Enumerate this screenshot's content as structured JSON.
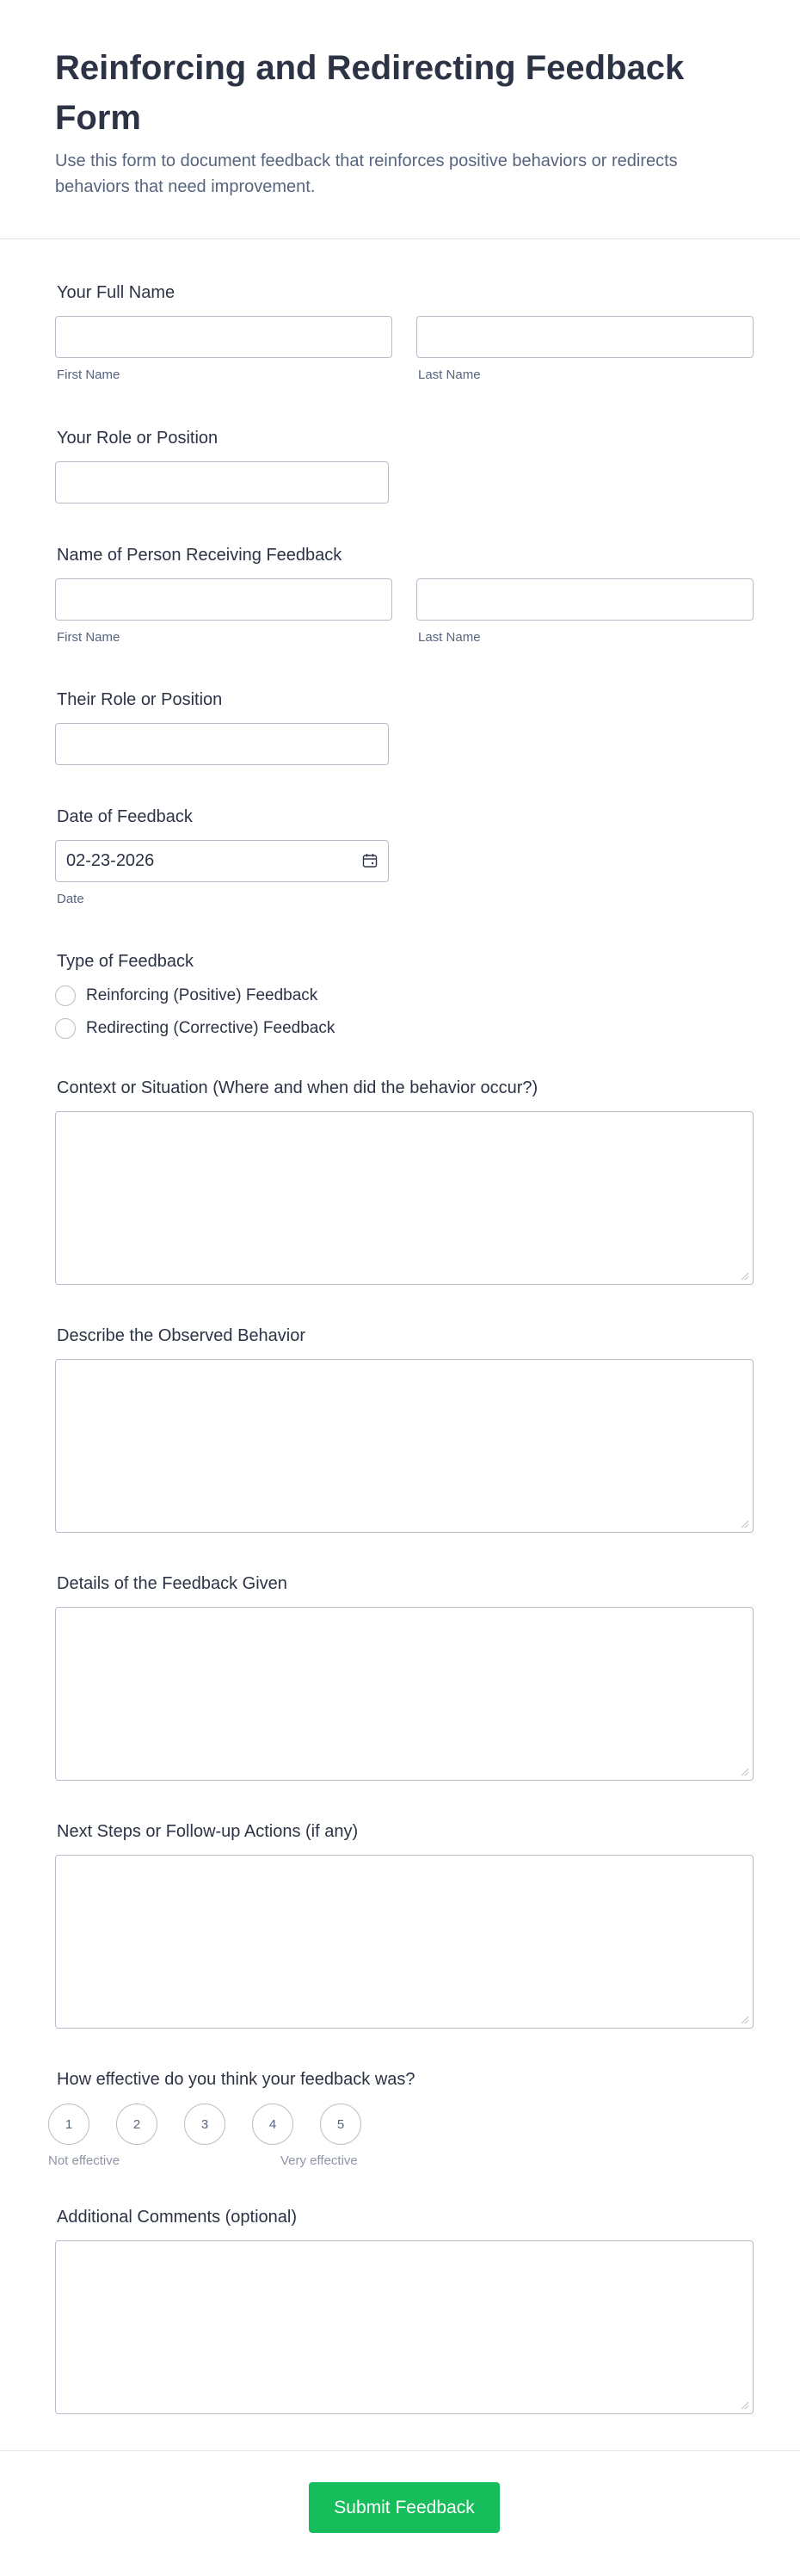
{
  "form": {
    "title": "Reinforcing and Redirecting Feedback Form",
    "subtitle": "Use this form to document feedback that reinforces positive behaviors or redirects behaviors that need improvement."
  },
  "fields": {
    "full_name": {
      "label": "Your Full Name",
      "first_value": "",
      "last_value": "",
      "first_sublabel": "First Name",
      "last_sublabel": "Last Name"
    },
    "role": {
      "label": "Your Role or Position",
      "value": ""
    },
    "receiver_name": {
      "label": "Name of Person Receiving Feedback",
      "first_value": "",
      "last_value": "",
      "first_sublabel": "First Name",
      "last_sublabel": "Last Name"
    },
    "their_role": {
      "label": "Their Role or Position",
      "value": ""
    },
    "date": {
      "label": "Date of Feedback",
      "value": "02-23-2026",
      "sublabel": "Date",
      "icon": "calendar-icon"
    },
    "feedback_type": {
      "label": "Type of Feedback",
      "options": [
        "Reinforcing (Positive) Feedback",
        "Redirecting (Corrective) Feedback"
      ],
      "selected": null
    },
    "context": {
      "label": "Context or Situation (Where and when did the behavior occur?)",
      "value": ""
    },
    "observed_behavior": {
      "label": "Describe the Observed Behavior",
      "value": ""
    },
    "feedback_details": {
      "label": "Details of the Feedback Given",
      "value": ""
    },
    "next_steps": {
      "label": "Next Steps or Follow-up Actions (if any)",
      "value": ""
    },
    "effectiveness": {
      "label": "How effective do you think your feedback was?",
      "options": [
        "1",
        "2",
        "3",
        "4",
        "5"
      ],
      "low_label": "Not effective",
      "high_label": "Very effective",
      "selected": null
    },
    "additional_comments": {
      "label": "Additional Comments (optional)",
      "value": ""
    }
  },
  "submit": {
    "label": "Submit Feedback"
  },
  "colors": {
    "primary_text": "#2c3345",
    "secondary_text": "#57647e",
    "border": "#b8bdc9",
    "submit_bg": "#18bd5b"
  }
}
